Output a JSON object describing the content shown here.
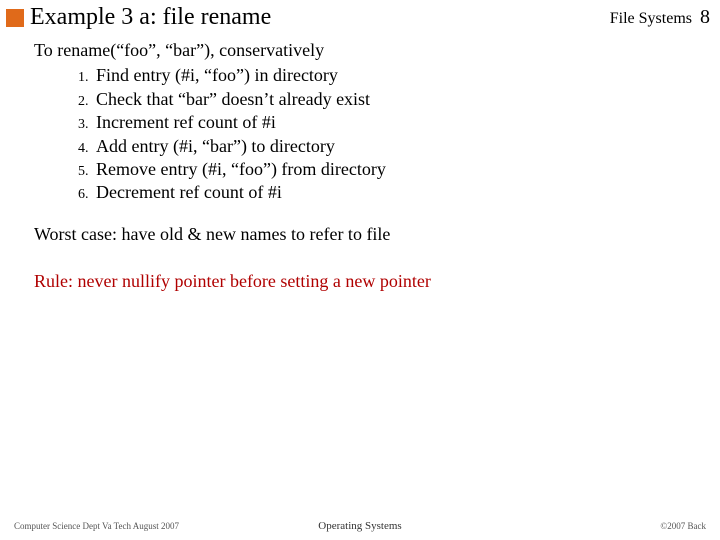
{
  "header": {
    "title": "Example 3 a: file rename",
    "section": "File Systems",
    "page": "8"
  },
  "body": {
    "intro": "To rename(“foo”, “bar”), conservatively",
    "steps": [
      "Find entry (#i, “foo”) in directory",
      "Check that “bar” doesn’t already exist",
      "Increment ref count of #i",
      "Add entry (#i, “bar”) to directory",
      "Remove entry (#i, “foo”) from directory",
      "Decrement ref count of #i"
    ],
    "worst": "Worst case: have old & new names to refer to file",
    "rule": "Rule: never nullify pointer before setting a new pointer"
  },
  "footer": {
    "left": "Computer Science Dept Va Tech August 2007",
    "center": "Operating Systems",
    "right": "©2007  Back"
  }
}
